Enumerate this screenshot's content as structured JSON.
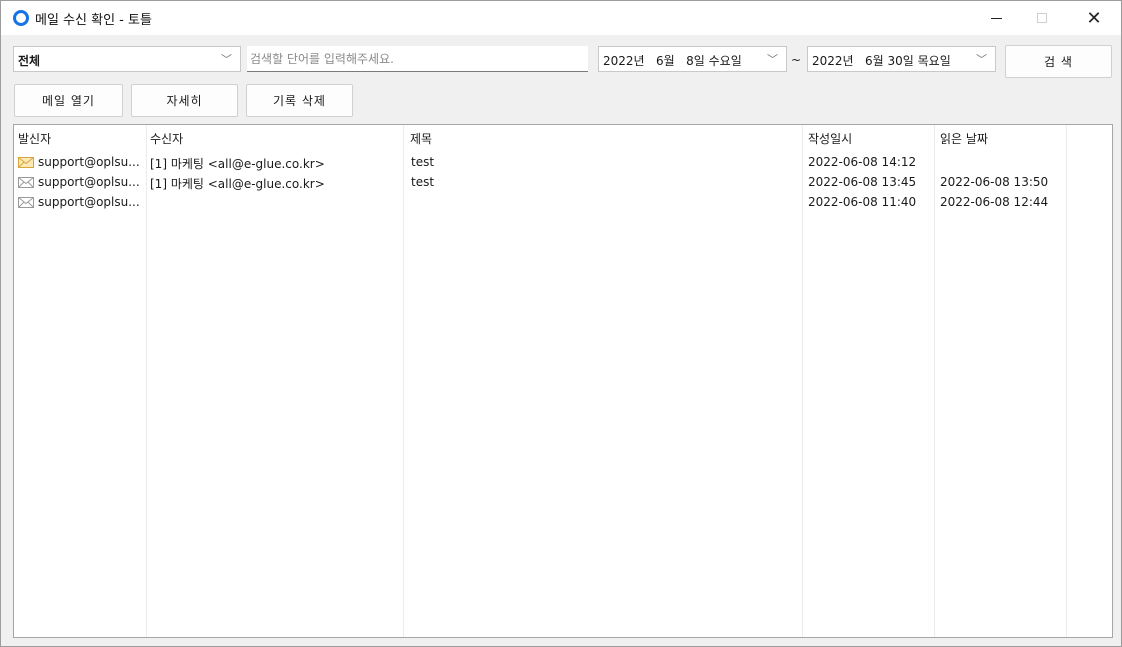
{
  "window": {
    "title": "메일 수신 확인 - 토틀",
    "minimize_glyph": "",
    "close_glyph": "✕"
  },
  "toolbar": {
    "filter_value": "전체",
    "search_placeholder": "검색할 단어를 입력해주세요.",
    "date_from": "2022년   6월   8일 수요일",
    "date_to": "2022년   6월 30일 목요일",
    "range_separator": "~",
    "search_button": "검 색",
    "open_mail_button": "메일 열기",
    "detail_button": "자세히",
    "delete_history_button": "기록 삭제"
  },
  "list": {
    "headers": [
      "발신자",
      "수신자",
      "제목",
      "작성일시",
      "읽은 날짜"
    ],
    "rows": [
      {
        "icon": "unread-envelope-icon",
        "sender": "support@oplsu...",
        "recipient": "[1] 마케팅 <all@e-glue.co.kr>",
        "subject": "test",
        "written": "2022-06-08 14:12",
        "read": ""
      },
      {
        "icon": "read-envelope-icon",
        "sender": "support@oplsu...",
        "recipient": "[1] 마케팅 <all@e-glue.co.kr>",
        "subject": "test",
        "written": "2022-06-08 13:45",
        "read": "2022-06-08 13:50"
      },
      {
        "icon": "read-envelope-icon",
        "sender": "support@oplsu...",
        "recipient": "",
        "subject": "",
        "written": "2022-06-08 11:40",
        "read": "2022-06-08 12:44"
      }
    ]
  },
  "colors": {
    "app_icon": "#1473e6",
    "unread_envelope": "#e8b84a",
    "read_envelope": "#9a9a9a"
  }
}
